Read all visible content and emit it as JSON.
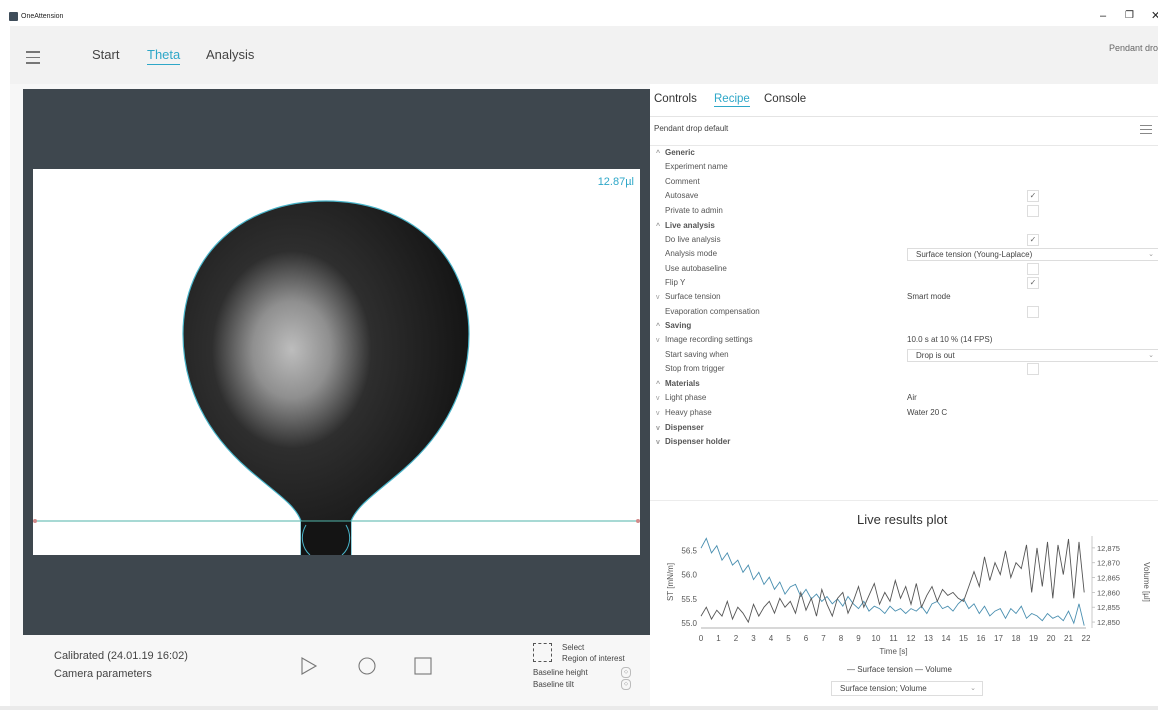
{
  "window": {
    "title": "OneAttension",
    "minimize": "–",
    "maximize": "❐",
    "close": "✕"
  },
  "nav": {
    "tabs": [
      {
        "label": "Start",
        "active": false
      },
      {
        "label": "Theta",
        "active": true
      },
      {
        "label": "Analysis",
        "active": false
      }
    ],
    "right_text": "Pendant dro"
  },
  "camera": {
    "volume_label": "12.87µl"
  },
  "status": {
    "calibrated": "Calibrated (24.01.19 16:02)",
    "camera_parameters": "Camera parameters"
  },
  "controls": {
    "play_icon": "play-icon",
    "record_icon": "record-icon",
    "stop_icon": "stop-icon",
    "roi_line1": "Select",
    "roi_line2": "Region of interest",
    "baseline_height": "Baseline height",
    "baseline_tilt": "Baseline tilt"
  },
  "right_panel": {
    "tabs": [
      {
        "label": "Controls",
        "active": false
      },
      {
        "label": "Recipe",
        "active": true
      },
      {
        "label": "Console",
        "active": false
      }
    ],
    "recipe_name": "Pendant drop default"
  },
  "recipe": {
    "generic": "Generic",
    "experiment_name": "Experiment name",
    "comment": "Comment",
    "autosave": "Autosave",
    "autosave_checked": true,
    "private_to_admin": "Private to admin",
    "private_checked": false,
    "live_analysis": "Live analysis",
    "do_live_analysis": "Do live analysis",
    "do_live_checked": true,
    "analysis_mode": "Analysis mode",
    "analysis_mode_value": "Surface tension (Young-Laplace)",
    "use_autobaseline": "Use autobaseline",
    "autobaseline_checked": false,
    "flip_y": "Flip Y",
    "flip_y_checked": true,
    "surface_tension": "Surface tension",
    "surface_tension_value": "Smart mode",
    "evaporation": "Evaporation compensation",
    "evaporation_checked": false,
    "saving": "Saving",
    "image_recording": "Image recording settings",
    "image_recording_value": "10.0 s at 10 % (14 FPS)",
    "start_saving_when": "Start saving when",
    "start_saving_value": "Drop is out",
    "stop_from_trigger": "Stop from trigger",
    "stop_trigger_checked": false,
    "materials": "Materials",
    "light_phase": "Light phase",
    "light_phase_value": "Air",
    "heavy_phase": "Heavy phase",
    "heavy_phase_value": "Water 20 C",
    "dispenser": "Dispenser",
    "dispenser_holder": "Dispenser holder",
    "check_glyph": "✓"
  },
  "plot_ui": {
    "select_value": "Surface tension; Volume"
  },
  "chart_data": {
    "type": "line",
    "title": "Live results plot",
    "xlabel": "Time [s]",
    "ylabel": "ST [mN/m]",
    "y2label": "Volume [µl]",
    "xlim": [
      0,
      22
    ],
    "ylim": [
      54.9,
      56.8
    ],
    "y2lim": [
      12.848,
      12.879
    ],
    "x_ticks": [
      0,
      1,
      2,
      3,
      4,
      5,
      6,
      7,
      8,
      9,
      10,
      11,
      12,
      13,
      14,
      15,
      16,
      17,
      18,
      19,
      20,
      21,
      22
    ],
    "y_ticks": [
      55.0,
      55.5,
      56.0,
      56.5
    ],
    "y_tick_labels": [
      "55.0",
      "55.5",
      "56.0",
      "56.5"
    ],
    "y2_ticks": [
      12.85,
      12.855,
      12.86,
      12.865,
      12.87,
      12.875
    ],
    "y2_tick_labels": [
      "12,850",
      "12,855",
      "12,860",
      "12,865",
      "12,870",
      "12,875"
    ],
    "legend": "— Surface tension — Volume",
    "series": [
      {
        "name": "Surface tension",
        "color": "#4a8fb0",
        "axis": "left",
        "x": [
          0,
          0.3,
          0.6,
          0.9,
          1.2,
          1.5,
          1.8,
          2.1,
          2.4,
          2.7,
          3,
          3.3,
          3.6,
          3.9,
          4.2,
          4.5,
          4.8,
          5.1,
          5.4,
          5.7,
          6,
          6.3,
          6.6,
          6.9,
          7.2,
          7.5,
          7.8,
          8.1,
          8.4,
          8.7,
          9,
          9.3,
          9.6,
          9.9,
          10.2,
          10.5,
          10.8,
          11.1,
          11.4,
          11.7,
          12,
          12.3,
          12.6,
          12.9,
          13.2,
          13.5,
          13.8,
          14.1,
          14.4,
          14.7,
          15,
          15.3,
          15.6,
          15.9,
          16.2,
          16.5,
          16.8,
          17.1,
          17.4,
          17.7,
          18,
          18.3,
          18.6,
          18.9,
          19.2,
          19.5,
          19.8,
          20.1,
          20.4,
          20.7,
          21,
          21.3,
          21.6,
          21.9
        ],
        "values": [
          56.55,
          56.75,
          56.45,
          56.6,
          56.3,
          56.45,
          56.2,
          56.3,
          56.05,
          56.2,
          55.9,
          56.05,
          55.8,
          55.95,
          55.7,
          55.85,
          55.6,
          55.75,
          55.8,
          55.55,
          55.7,
          55.5,
          55.6,
          55.45,
          55.55,
          55.4,
          55.5,
          55.35,
          55.55,
          55.4,
          55.3,
          55.45,
          55.25,
          55.35,
          55.3,
          55.2,
          55.35,
          55.25,
          55.3,
          55.2,
          55.3,
          55.25,
          55.35,
          55.2,
          55.4,
          55.45,
          55.3,
          55.35,
          55.25,
          55.4,
          55.5,
          55.3,
          55.4,
          55.2,
          55.35,
          55.15,
          55.25,
          55.3,
          55.1,
          55.3,
          55.2,
          55.35,
          55.1,
          55.2,
          55.15,
          55.05,
          55.2,
          55.1,
          55.15,
          55.05,
          55.25,
          55.0,
          55.4,
          54.95
        ]
      },
      {
        "name": "Volume",
        "color": "#555555",
        "axis": "right",
        "x": [
          0,
          0.3,
          0.6,
          0.9,
          1.2,
          1.5,
          1.8,
          2.1,
          2.4,
          2.7,
          3,
          3.3,
          3.6,
          3.9,
          4.2,
          4.5,
          4.8,
          5.1,
          5.4,
          5.7,
          6,
          6.3,
          6.6,
          6.9,
          7.2,
          7.5,
          7.8,
          8.1,
          8.4,
          8.7,
          9,
          9.3,
          9.6,
          9.9,
          10.2,
          10.5,
          10.8,
          11.1,
          11.4,
          11.7,
          12,
          12.3,
          12.6,
          12.9,
          13.2,
          13.5,
          13.8,
          14.1,
          14.4,
          14.7,
          15,
          15.3,
          15.6,
          15.9,
          16.2,
          16.5,
          16.8,
          17.1,
          17.4,
          17.7,
          18,
          18.3,
          18.6,
          18.9,
          19.2,
          19.5,
          19.8,
          20.1,
          20.4,
          20.7,
          21,
          21.3,
          21.6,
          21.9
        ],
        "values": [
          12.852,
          12.855,
          12.851,
          12.854,
          12.852,
          12.857,
          12.851,
          12.855,
          12.853,
          12.85,
          12.856,
          12.852,
          12.855,
          12.857,
          12.853,
          12.858,
          12.855,
          12.857,
          12.853,
          12.86,
          12.854,
          12.858,
          12.852,
          12.861,
          12.856,
          12.852,
          12.858,
          12.86,
          12.853,
          12.857,
          12.862,
          12.855,
          12.859,
          12.863,
          12.856,
          12.86,
          12.857,
          12.864,
          12.858,
          12.862,
          12.856,
          12.863,
          12.855,
          12.859,
          12.862,
          12.857,
          12.861,
          12.859,
          12.86,
          12.858,
          12.857,
          12.862,
          12.867,
          12.862,
          12.872,
          12.864,
          12.87,
          12.866,
          12.874,
          12.865,
          12.87,
          12.868,
          12.876,
          12.86,
          12.875,
          12.862,
          12.877,
          12.858,
          12.876,
          12.866,
          12.878,
          12.858,
          12.877,
          12.86
        ]
      }
    ]
  }
}
